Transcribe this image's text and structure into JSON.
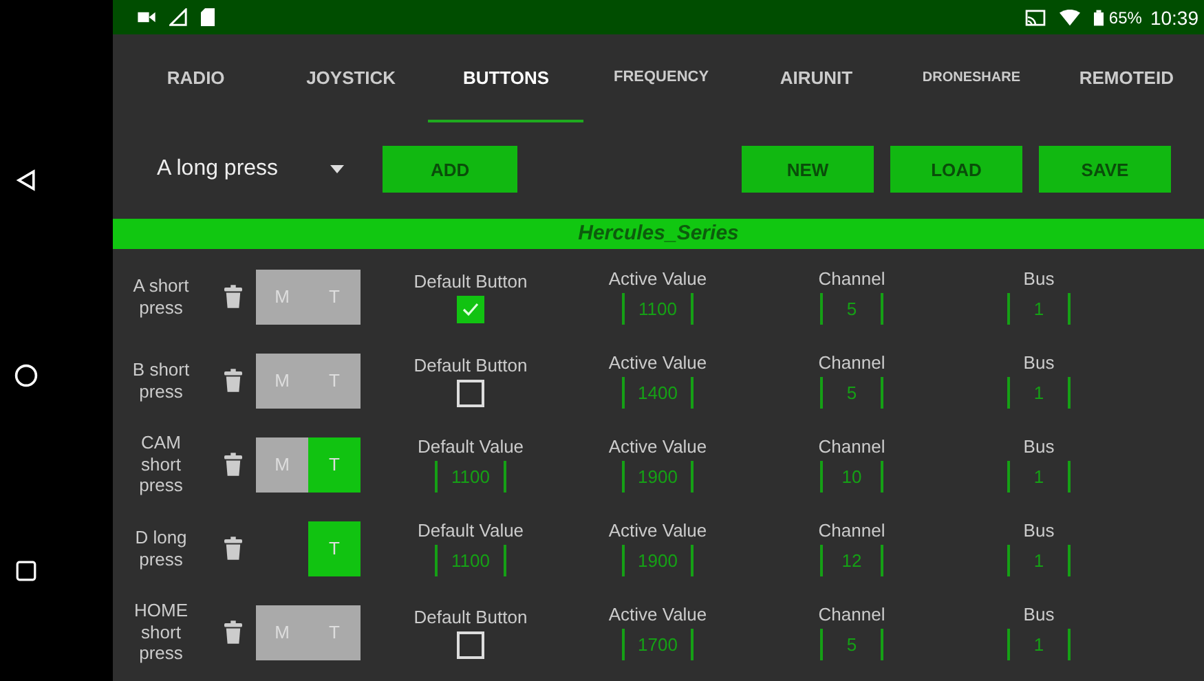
{
  "status_bar": {
    "battery": "65%",
    "time": "10:39"
  },
  "tabs": [
    {
      "label": "RADIO",
      "selected": false
    },
    {
      "label": "JOYSTICK",
      "selected": false
    },
    {
      "label": "BUTTONS",
      "selected": true
    },
    {
      "label": "FREQUENCY",
      "selected": false
    },
    {
      "label": "AIRUNIT",
      "selected": false
    },
    {
      "label": "DRONESHARE",
      "selected": false
    },
    {
      "label": "REMOTEID",
      "selected": false
    }
  ],
  "dropdown": {
    "value": "A long press"
  },
  "buttons": {
    "add": "ADD",
    "new": "NEW",
    "load": "LOAD",
    "save": "SAVE"
  },
  "profile_title": "Hercules_Series",
  "rows": [
    {
      "name": "A short press",
      "modes": [
        {
          "label": "M",
          "on": false
        },
        {
          "label": "T",
          "on": false
        }
      ],
      "default": {
        "kind": "checkbox",
        "label": "Default Button",
        "checked": true
      },
      "active_label": "Active Value",
      "active": "1100",
      "channel_label": "Channel",
      "channel": "5",
      "bus_label": "Bus",
      "bus": "1"
    },
    {
      "name": "B short press",
      "modes": [
        {
          "label": "M",
          "on": false
        },
        {
          "label": "T",
          "on": false
        }
      ],
      "default": {
        "kind": "checkbox",
        "label": "Default Button",
        "checked": false
      },
      "active_label": "Active Value",
      "active": "1400",
      "channel_label": "Channel",
      "channel": "5",
      "bus_label": "Bus",
      "bus": "1"
    },
    {
      "name": "CAM short press",
      "modes": [
        {
          "label": "M",
          "on": false
        },
        {
          "label": "T",
          "on": true
        }
      ],
      "default": {
        "kind": "value",
        "label": "Default Value",
        "value": "1100"
      },
      "active_label": "Active Value",
      "active": "1900",
      "channel_label": "Channel",
      "channel": "10",
      "bus_label": "Bus",
      "bus": "1"
    },
    {
      "name": "D long press",
      "modes": [
        {
          "label": "T",
          "on": true
        }
      ],
      "default": {
        "kind": "value",
        "label": "Default Value",
        "value": "1100"
      },
      "active_label": "Active Value",
      "active": "1900",
      "channel_label": "Channel",
      "channel": "12",
      "bus_label": "Bus",
      "bus": "1"
    },
    {
      "name": "HOME short press",
      "modes": [
        {
          "label": "M",
          "on": false
        },
        {
          "label": "T",
          "on": false
        }
      ],
      "default": {
        "kind": "checkbox",
        "label": "Default Button",
        "checked": false
      },
      "active_label": "Active Value",
      "active": "1700",
      "channel_label": "Channel",
      "channel": "5",
      "bus_label": "Bus",
      "bus": "1"
    }
  ]
}
